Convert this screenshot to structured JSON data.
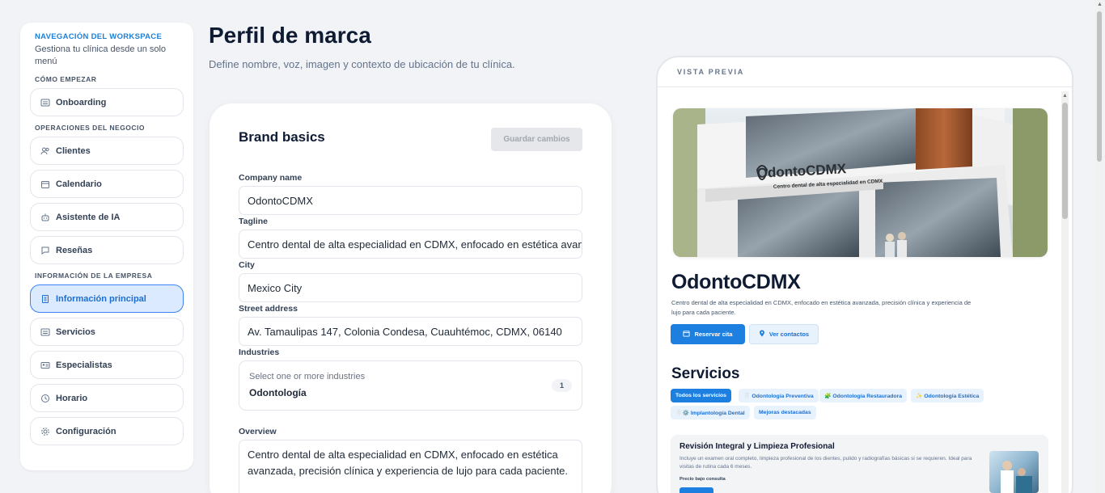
{
  "sidebar": {
    "title": "NAVEGACIÓN DEL WORKSPACE",
    "subtitle": "Gestiona tu clínica desde un solo menú",
    "sections": {
      "start": "CÓMO EMPEZAR",
      "ops": "OPERACIONES DEL NEGOCIO",
      "company": "INFORMACIÓN DE LA EMPRESA"
    },
    "items": {
      "onboarding": "Onboarding",
      "clientes": "Clientes",
      "calendario": "Calendario",
      "asistente": "Asistente de IA",
      "resenas": "Reseñas",
      "info": "Información principal",
      "servicios": "Servicios",
      "especialistas": "Especialistas",
      "horario": "Horario",
      "configuracion": "Configuración"
    },
    "active_item": "Información principal"
  },
  "header": {
    "title": "Perfil de marca",
    "subtitle": "Define nombre, voz, imagen y contexto de ubicación de tu clínica."
  },
  "form": {
    "title": "Brand basics",
    "save_label": "Guardar cambios",
    "company_label": "Company name",
    "company_value": "OdontoCDMX",
    "tagline_label": "Tagline",
    "tagline_value": "Centro dental de alta especialidad en CDMX, enfocado en estética avanzada, precisión clínica y experiencia de lujo para cada paciente.",
    "city_label": "City",
    "city_value": "Mexico City",
    "street_label": "Street address",
    "street_value": "Av. Tamaulipas 147, Colonia Condesa, Cuauhtémoc, CDMX, 06140",
    "industries_label": "Industries",
    "industries_placeholder": "Select one or more industries",
    "industries_value": "Odontología",
    "industries_count": "1",
    "overview_label": "Overview",
    "overview_value": "Centro dental de alta especialidad en CDMX, enfocado en estética avanzada, precisión clínica y experiencia de lujo para cada paciente."
  },
  "preview": {
    "label": "VISTA PREVIA",
    "hero_sign": "OdontoCDMX",
    "hero_sign_sub": "Centro dental de alta especialidad en CDMX",
    "brand_name": "OdontoCDMX",
    "tagline": "Centro dental de alta especialidad en CDMX, enfocado en estética avanzada, precisión clínica y experiencia de lujo para cada paciente.",
    "book_label": "Reservar cita",
    "contacts_label": "Ver contactos",
    "services_title": "Servicios",
    "chips": [
      {
        "label": "Todos los servicios",
        "active": true
      },
      {
        "label": "🦷 Odontología Preventiva",
        "active": false
      },
      {
        "label": "🧩 Odontología Restauradora",
        "active": false
      },
      {
        "label": "✨ Odontología Estética",
        "active": false
      },
      {
        "label": "🦷⚙️ Implantología Dental",
        "active": false
      },
      {
        "label": "Mejoras destacadas",
        "active": false
      }
    ],
    "service": {
      "name": "Revisión Integral y Limpieza Profesional",
      "description": "Incluye un examen oral completo, limpieza profesional de los dientes, pulido y radiografías básicas si se requieren. Ideal para visitas de rutina cada 6 meses.",
      "price_label": "Precio bajo consulta"
    }
  },
  "colors": {
    "accent": "#1d7fe0",
    "active_bg": "#dbeafe",
    "title": "#0f1b33"
  }
}
